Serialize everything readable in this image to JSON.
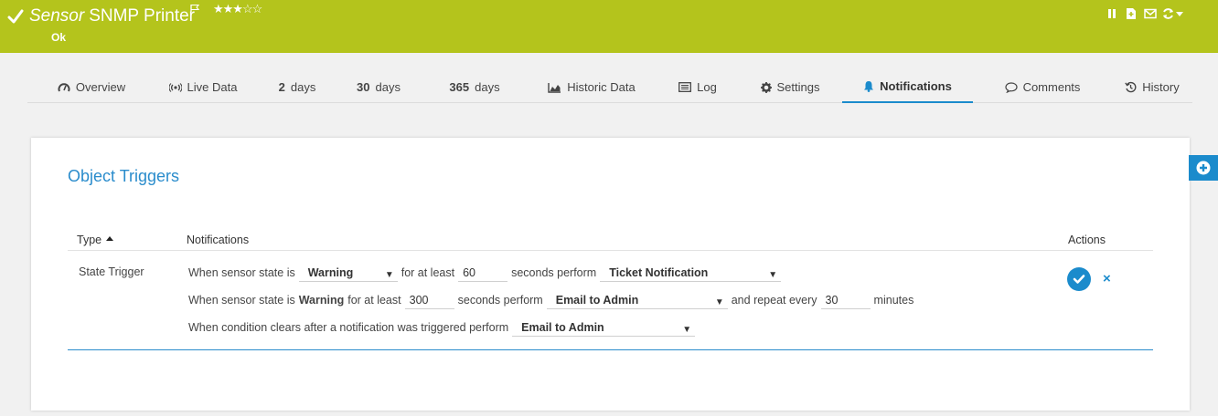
{
  "header": {
    "sensor_kind": "Sensor",
    "sensor_name": "SNMP Printer",
    "status": "Ok",
    "priority_stars": "★★★☆☆",
    "priority_level": 3,
    "color": "#b4c41c"
  },
  "tabs": [
    {
      "label": "Overview",
      "icon": "gauge-icon"
    },
    {
      "label": "Live Data",
      "icon": "broadcast-icon"
    },
    {
      "num": "2",
      "label": "days"
    },
    {
      "num": "30",
      "label": "days"
    },
    {
      "num": "365",
      "label": "days"
    },
    {
      "label": "Historic Data",
      "icon": "area-chart-icon"
    },
    {
      "label": "Log",
      "icon": "list-icon"
    },
    {
      "label": "Settings",
      "icon": "gear-icon"
    },
    {
      "label": "Notifications",
      "icon": "bell-icon",
      "active": true
    },
    {
      "label": "Comments",
      "icon": "comment-icon"
    },
    {
      "label": "History",
      "icon": "history-icon"
    }
  ],
  "card": {
    "heading": "Object Triggers",
    "columns": {
      "type": "Type",
      "notifications": "Notifications",
      "actions": "Actions"
    }
  },
  "trigger": {
    "type": "State Trigger",
    "line1": {
      "prefix": "When sensor state is",
      "state": "Warning",
      "mid": "for at least",
      "seconds": "60",
      "perform": "seconds perform",
      "notification": "Ticket Notification"
    },
    "line2": {
      "prefix": "When sensor state is",
      "state": "Warning",
      "mid": "for at least",
      "seconds": "300",
      "perform": "seconds perform",
      "notification": "Email to Admin",
      "repeat": "and repeat every",
      "minutes": "30",
      "unit": "minutes"
    },
    "line3": {
      "prefix": "When condition clears after a notification was triggered perform",
      "notification": "Email to Admin"
    }
  },
  "colors": {
    "accent": "#1b8bcc",
    "header": "#b4c41c"
  }
}
